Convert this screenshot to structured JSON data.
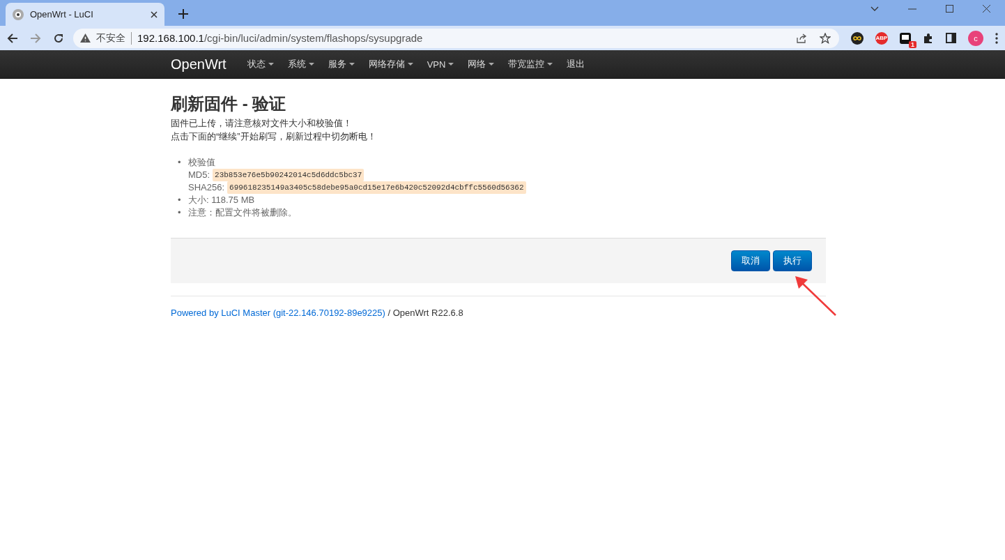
{
  "browser": {
    "tab_title": "OpenWrt - LuCI",
    "security_label": "不安全",
    "url_host": "192.168.100.1",
    "url_path": "/cgi-bin/luci/admin/system/flashops/sysupgrade",
    "extension_badge": "1",
    "abp_label": "ABP",
    "profile_initial": "c"
  },
  "navbar": {
    "brand": "OpenWrt",
    "items": [
      {
        "label": "状态",
        "dropdown": true
      },
      {
        "label": "系统",
        "dropdown": true
      },
      {
        "label": "服务",
        "dropdown": true
      },
      {
        "label": "网络存储",
        "dropdown": true
      },
      {
        "label": "VPN",
        "dropdown": true
      },
      {
        "label": "网络",
        "dropdown": true
      },
      {
        "label": "带宽监控",
        "dropdown": true
      },
      {
        "label": "退出",
        "dropdown": false
      }
    ]
  },
  "page": {
    "title": "刷新固件 - 验证",
    "intro": [
      "固件已上传，请注意核对文件大小和校验值！",
      "点击下面的“继续”开始刷写，刷新过程中切勿断电！"
    ],
    "bullets": [
      "•",
      "•",
      "•"
    ],
    "checksum_label": "校验值",
    "hashes": [
      {
        "label": "MD5:",
        "value": "23b853e76e5b90242014c5d6ddc5bc37"
      },
      {
        "label": "SHA256:",
        "value": "699618235149a3405c58debe95a0cd15e17e6b420c52092d4cbffc5560d56362"
      }
    ],
    "size": "大小: 118.75 MB",
    "note": "注意：配置文件将被删除。",
    "buttons": [
      "取消",
      "执行"
    ]
  },
  "footer": {
    "link": "Powered by LuCI Master (git-22.146.70192-89e9225)",
    "text": "/ OpenWrt R22.6.8"
  }
}
